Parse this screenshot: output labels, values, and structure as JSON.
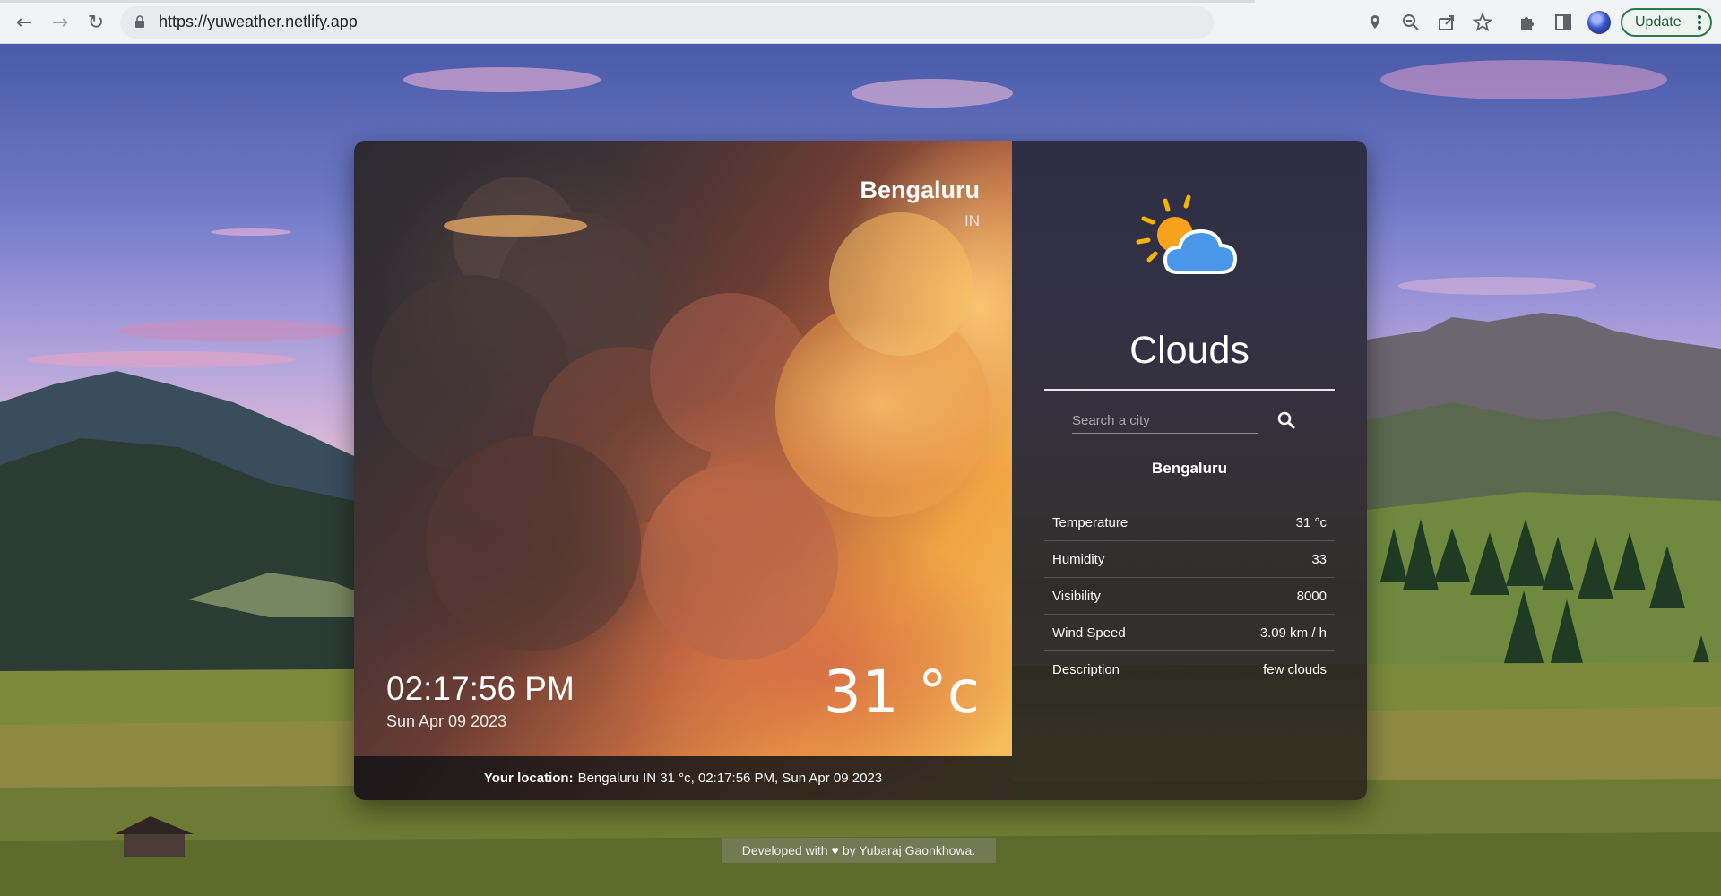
{
  "browser": {
    "url": "https://yuweather.netlify.app",
    "update_label": "Update"
  },
  "weather": {
    "city": "Bengaluru",
    "country": "IN",
    "time": "02:17:56 PM",
    "date": "Sun Apr 09 2023",
    "temperature_big": "31 °c",
    "location_label": "Your location:",
    "location_text": "Bengaluru IN 31 °c, 02:17:56 PM, Sun Apr 09 2023",
    "condition": "Clouds",
    "icon": "sun-behind-cloud-icon"
  },
  "search": {
    "placeholder": "Search a city",
    "result_city": "Bengaluru"
  },
  "details": [
    {
      "label": "Temperature",
      "value": "31 °c"
    },
    {
      "label": "Humidity",
      "value": "33"
    },
    {
      "label": "Visibility",
      "value": "8000"
    },
    {
      "label": "Wind Speed",
      "value": "3.09 km / h"
    },
    {
      "label": "Description",
      "value": "few clouds"
    }
  ],
  "footer": {
    "before": "Developed with",
    "after": "by Yubaraj Gaonkhowa."
  }
}
